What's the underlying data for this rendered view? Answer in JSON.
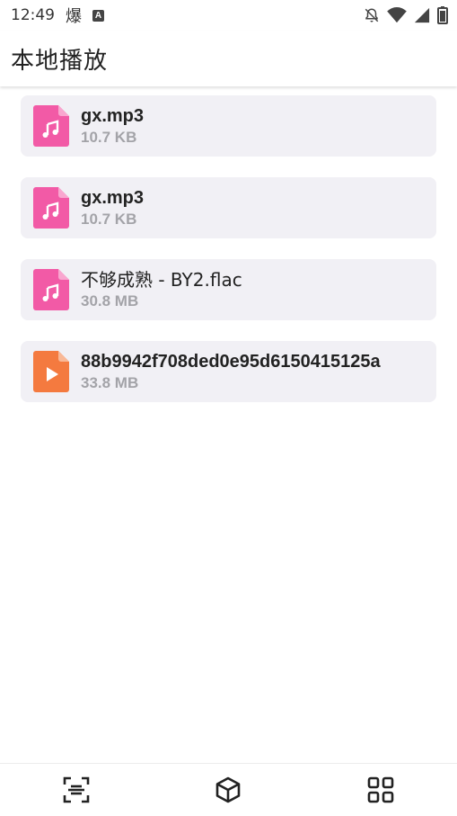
{
  "status_bar": {
    "time": "12:49",
    "notification_glyph": "爆",
    "a_badge": "A",
    "icons": [
      "mute-bell-icon",
      "wifi-icon",
      "signal-icon",
      "battery-icon"
    ]
  },
  "app_bar": {
    "title": "本地播放"
  },
  "files": [
    {
      "name": "gx.mp3",
      "size": "10.7 KB",
      "icon": "audio-file-icon",
      "color": "#f25aa6"
    },
    {
      "name": "gx.mp3",
      "size": "10.7 KB",
      "icon": "audio-file-icon",
      "color": "#f25aa6"
    },
    {
      "name": "不够成熟 - BY2.flac",
      "size": "30.8 MB",
      "icon": "audio-file-icon",
      "color": "#f25aa6"
    },
    {
      "name": "88b9942f708ded0e95d6150415125a",
      "size": "33.8 MB",
      "icon": "video-file-icon",
      "color": "#f47a3f"
    }
  ],
  "bottom_nav": [
    "scan-icon",
    "cube-icon",
    "grid-icon"
  ]
}
